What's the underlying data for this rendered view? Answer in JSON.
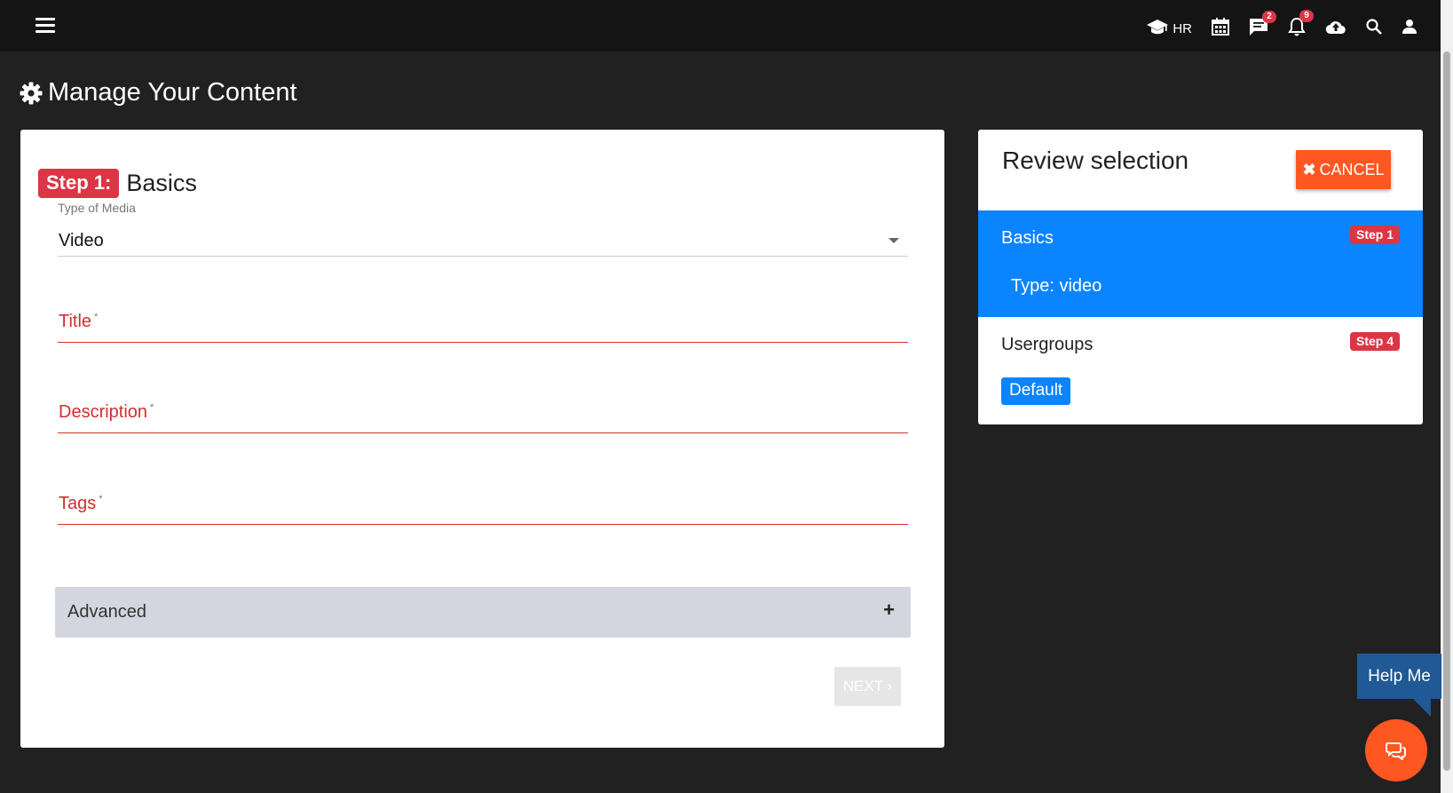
{
  "topbar": {
    "hr_label": "HR",
    "messages_count": "2",
    "notifications_count": "9"
  },
  "page": {
    "title": "Manage Your Content"
  },
  "form": {
    "step_chip": "Step 1:",
    "step_name": "Basics",
    "media_label": "Type of Media",
    "media_value": "Video",
    "fields": {
      "title": "Title",
      "description": "Description",
      "tags": "Tags",
      "required_mark": "*"
    },
    "advanced_label": "Advanced",
    "advanced_icon": "+",
    "next_label": "NEXT ›"
  },
  "review": {
    "title": "Review selection",
    "cancel_label": "CANCEL",
    "cancel_icon": "✖",
    "basics": {
      "title": "Basics",
      "step": "Step 1",
      "type_text": "Type: video"
    },
    "usergroups": {
      "title": "Usergroups",
      "step": "Step 4",
      "group": "Default"
    }
  },
  "help": {
    "label": "Help Me"
  },
  "colors": {
    "accent_red": "#dc3545",
    "accent_orange": "#ff5722",
    "accent_blue": "#0b84ff",
    "help_blue": "#1f5996",
    "error_red": "#d32f2f"
  }
}
